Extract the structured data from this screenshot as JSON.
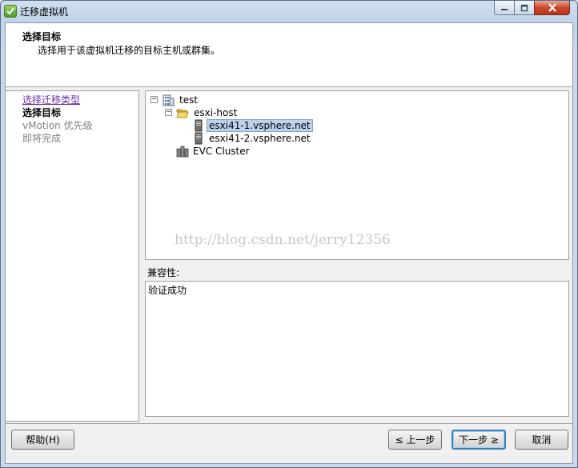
{
  "window": {
    "title": "迁移虚拟机",
    "app_icon": "vsphere-app-icon",
    "controls": {
      "minimize_icon": "minimize-icon",
      "maximize_icon": "maximize-icon",
      "close_icon": "close-icon"
    }
  },
  "header": {
    "title": "选择目标",
    "subtitle": "选择用于该虚拟机迁移的目标主机或群集。"
  },
  "steps": [
    {
      "label": "选择迁移类型",
      "state": "visited-link"
    },
    {
      "label": "选择目标",
      "state": "current"
    },
    {
      "label": "vMotion 优先级",
      "state": "pending"
    },
    {
      "label": "即将完成",
      "state": "pending"
    }
  ],
  "tree": {
    "nodes": [
      {
        "label": "test",
        "icon": "datacenter-icon",
        "expander": "−"
      },
      {
        "label": "esxi-host",
        "icon": "folder-open-icon",
        "expander": "−"
      },
      {
        "label": "esxi41-1.vsphere.net",
        "icon": "host-icon",
        "selected": true
      },
      {
        "label": "esxi41-2.vsphere.net",
        "icon": "host-icon",
        "selected": false
      },
      {
        "label": "EVC Cluster",
        "icon": "cluster-icon"
      }
    ]
  },
  "watermark": "http://blog.csdn.net/jerry12356",
  "compatibility": {
    "label": "兼容性:",
    "result": "验证成功"
  },
  "buttons": {
    "help": "帮助(H)",
    "back": "≤ 上一步",
    "next": "下一步 ≥",
    "cancel": "取消"
  },
  "colors": {
    "selection": "#bcd2ec",
    "visited_link": "#6b2fa8",
    "close_button": "#c9472d"
  }
}
